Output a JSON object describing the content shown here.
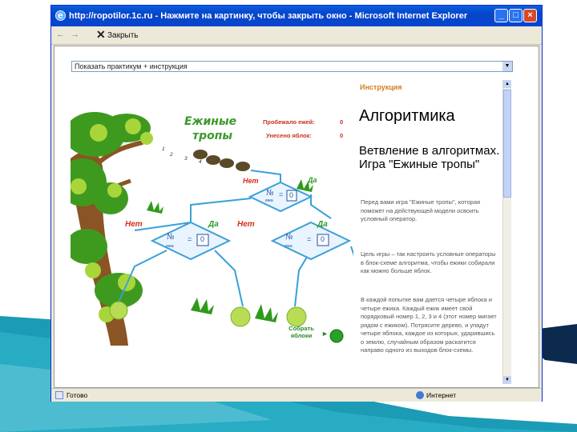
{
  "window": {
    "title": "http://ropotilor.1c.ru - Нажмите на картинку, чтобы закрыть окно - Microsoft Internet Explorer",
    "minimize_label": "_",
    "maximize_label": "□",
    "close_label": "×"
  },
  "toolbar": {
    "back_label": "←",
    "forward_label": "→",
    "close_label": "Закрыть"
  },
  "dropdown": {
    "selected": "Показать практикум + инструкция"
  },
  "game": {
    "title_line1": "Ежиные",
    "title_line2": "тропы",
    "stat_hedgehogs_label": "Пробежало ежей:",
    "stat_hedgehogs_value": "0",
    "stat_apples_label": "Унесено яблок:",
    "stat_apples_value": "0",
    "hedgehog_numbers": [
      "1",
      "2",
      "3",
      "4"
    ],
    "top_node": {
      "no": "№",
      "sub": "ежа",
      "op": "=",
      "value": "0",
      "no_label": "Нет",
      "yes_label": "Да"
    },
    "left_node": {
      "no": "№",
      "sub": "ежа",
      "op": "=",
      "value": "0",
      "no_label": "Нет",
      "yes_label": "Да"
    },
    "right_node": {
      "no": "№",
      "sub": "ежа",
      "op": "=",
      "value": "0",
      "no_label": "Нет",
      "yes_label": "Да"
    },
    "collect_label_line1": "Собрать",
    "collect_label_line2": "яблоки",
    "collect_arrow": "►"
  },
  "instruction": {
    "header": "Инструкция",
    "title": "Алгоритмика",
    "subtitle": "Ветвление в алгоритмах. Игра \"Ежиные тропы\"",
    "p1": "Перед вами игра \"Ежиные тропы\", которая поможет на действующей модели освоить условный оператор.",
    "p2": "Цель игры – так настроить условные операторы в блок-схеме алгоритма, чтобы ежики собирали как можно больше яблок.",
    "p3": "В каждой попытке вам дается четыре яблока и четыре ежика. Каждый ежик имеет свой порядковый номер 1, 2, 3 и 4 (этот номер мигает рядом с ежиком). Потрясите дерево, и упадут четыре яблока, каждое из которых, ударившись о землю, случайным образом раскатится направо одного из выходов блок-схемы."
  },
  "status": {
    "left": "Готово",
    "zone": "Интернет"
  },
  "colors": {
    "title_bar": "#0545c9",
    "slide_accent_teal": "#1b9bb6",
    "slide_accent_dark": "#0b2a4e",
    "tree_branch": "#7a4a1e",
    "flow_lines": "#3aa0d8",
    "node_fill": "#eaf4ff",
    "instruction_header": "#d4801a"
  }
}
